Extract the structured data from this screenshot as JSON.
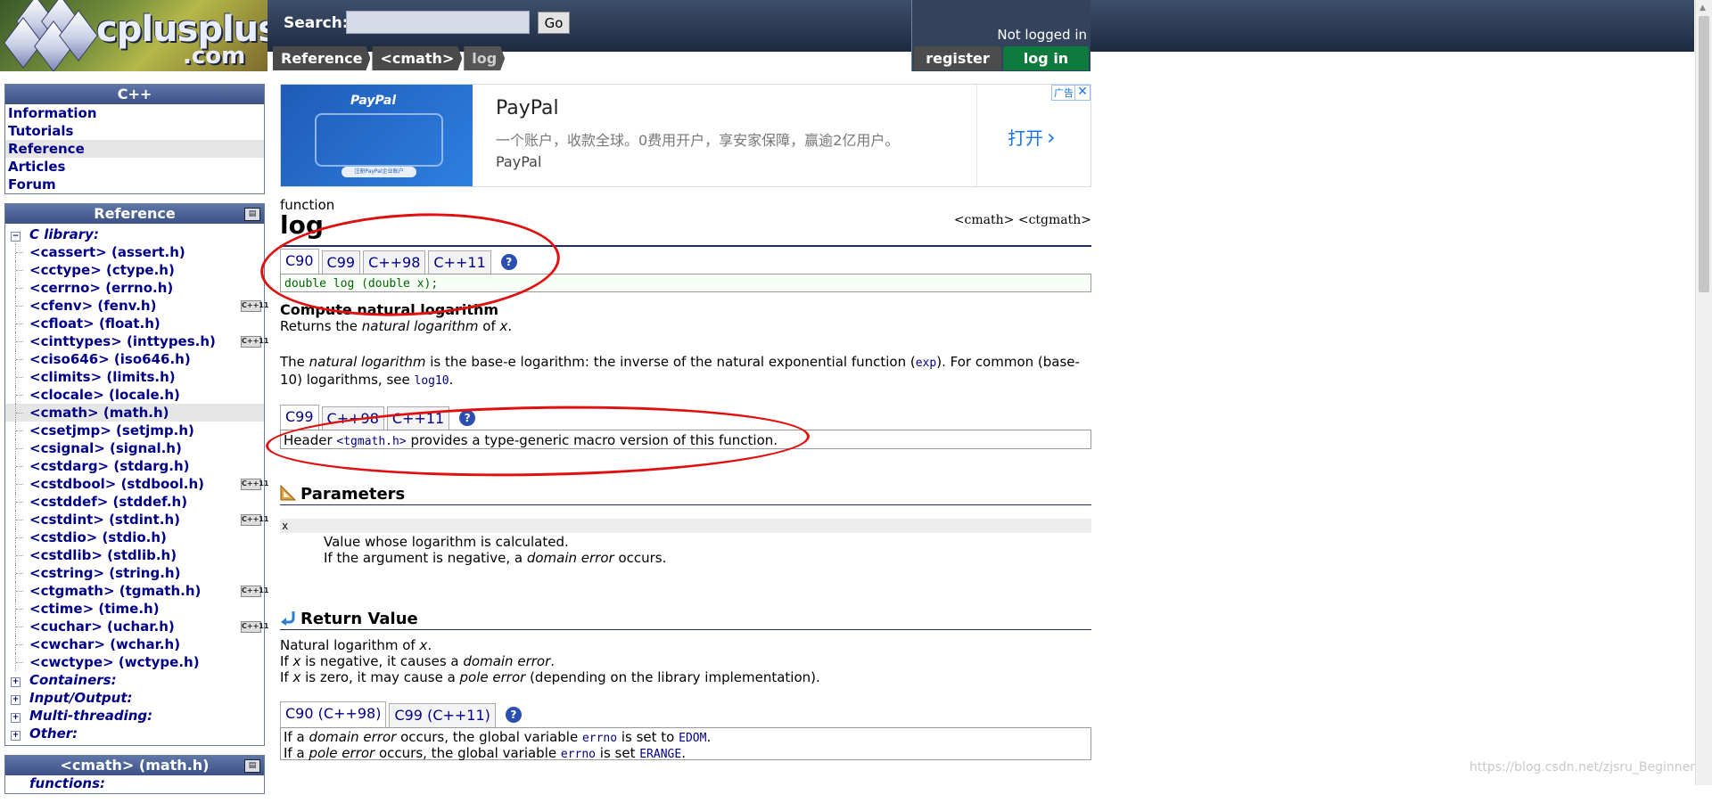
{
  "header": {
    "logo_text": "cplusplus",
    "logo_suffix": ".com",
    "search_label": "Search:",
    "search_value": "",
    "go_label": "Go",
    "login_status": "Not logged in",
    "register_label": "register",
    "login_label": "log in"
  },
  "breadcrumb": [
    "Reference",
    "<cmath>",
    "log"
  ],
  "sidebar": {
    "cpp_title": "C++",
    "cpp_items": [
      "Information",
      "Tutorials",
      "Reference",
      "Articles",
      "Forum"
    ],
    "reference_title": "Reference",
    "c_library_label": "C library:",
    "libraries": [
      {
        "label": "<cassert> (assert.h)",
        "badge": ""
      },
      {
        "label": "<cctype> (ctype.h)",
        "badge": ""
      },
      {
        "label": "<cerrno> (errno.h)",
        "badge": ""
      },
      {
        "label": "<cfenv> (fenv.h)",
        "badge": "C++11"
      },
      {
        "label": "<cfloat> (float.h)",
        "badge": ""
      },
      {
        "label": "<cinttypes> (inttypes.h)",
        "badge": "C++11"
      },
      {
        "label": "<ciso646> (iso646.h)",
        "badge": ""
      },
      {
        "label": "<climits> (limits.h)",
        "badge": ""
      },
      {
        "label": "<clocale> (locale.h)",
        "badge": ""
      },
      {
        "label": "<cmath> (math.h)",
        "badge": ""
      },
      {
        "label": "<csetjmp> (setjmp.h)",
        "badge": ""
      },
      {
        "label": "<csignal> (signal.h)",
        "badge": ""
      },
      {
        "label": "<cstdarg> (stdarg.h)",
        "badge": ""
      },
      {
        "label": "<cstdbool> (stdbool.h)",
        "badge": "C++11"
      },
      {
        "label": "<cstddef> (stddef.h)",
        "badge": ""
      },
      {
        "label": "<cstdint> (stdint.h)",
        "badge": "C++11"
      },
      {
        "label": "<cstdio> (stdio.h)",
        "badge": ""
      },
      {
        "label": "<cstdlib> (stdlib.h)",
        "badge": ""
      },
      {
        "label": "<cstring> (string.h)",
        "badge": ""
      },
      {
        "label": "<ctgmath> (tgmath.h)",
        "badge": "C++11"
      },
      {
        "label": "<ctime> (time.h)",
        "badge": ""
      },
      {
        "label": "<cuchar> (uchar.h)",
        "badge": "C++11"
      },
      {
        "label": "<cwchar> (wchar.h)",
        "badge": ""
      },
      {
        "label": "<cwctype> (wctype.h)",
        "badge": ""
      }
    ],
    "categories": [
      "Containers:",
      "Input/Output:",
      "Multi-threading:",
      "Other:"
    ],
    "cmath_title": "<cmath> (math.h)",
    "functions_label": "functions:"
  },
  "ad": {
    "image_brand": "PayPal",
    "image_caption": "注册PayPal企业账户",
    "title": "PayPal",
    "description": "一个账户，收款全球。0费用开户，享安家保障，赢逾2亿用户。",
    "brand": "PayPal",
    "open_label": "打开",
    "tag": "广告",
    "close": "✕"
  },
  "content": {
    "kind": "function",
    "name": "log",
    "headers": "<cmath> <ctgmath>",
    "proto_tabs": [
      "C90",
      "C99",
      "C++98",
      "C++11"
    ],
    "prototype": "double log (double x);",
    "section_head": "Compute natural logarithm",
    "summary_pre": "Returns the ",
    "summary_em": "natural logarithm",
    "summary_mid": " of ",
    "summary_x": "x",
    "summary_end": ".",
    "desc_pre": "The ",
    "desc_em": "natural logarithm",
    "desc_mid": " is the base-e logarithm: the inverse of the natural exponential function (",
    "desc_exp": "exp",
    "desc_mid2": "). For common (base-10) logarithms, see ",
    "desc_log10": "log10",
    "desc_end": ".",
    "tg_tabs": [
      "C99",
      "C++98",
      "C++11"
    ],
    "tg_pre": "Header ",
    "tg_header": "<tgmath.h>",
    "tg_post": " provides a type-generic macro version of this function.",
    "help": "?",
    "params_title": "Parameters",
    "param_name": "x",
    "param_desc1": "Value whose logarithm is calculated.",
    "param_desc2_pre": "If the argument is negative, a ",
    "param_desc2_em": "domain error",
    "param_desc2_post": " occurs.",
    "return_title": "Return Value",
    "ret1_pre": "Natural logarithm of ",
    "ret1_x": "x",
    "ret1_end": ".",
    "ret2_pre": "If ",
    "ret2_x": "x",
    "ret2_mid": " is negative, it causes a ",
    "ret2_em": "domain error",
    "ret2_end": ".",
    "ret3_pre": "If ",
    "ret3_x": "x",
    "ret3_mid": " is zero, it may cause a ",
    "ret3_em": "pole error",
    "ret3_end": " (depending on the library implementation).",
    "err_tabs": [
      "C90 (C++98)",
      "C99 (C++11)"
    ],
    "err1_pre": "If a ",
    "err1_em": "domain error",
    "err1_mid": " occurs, the global variable ",
    "err1_var": "errno",
    "err1_mid2": " is set to ",
    "err1_val": "EDOM",
    "err1_end": ".",
    "err2_pre": "If a ",
    "err2_em": "pole error",
    "err2_mid": " occurs, the global variable ",
    "err2_var": "errno",
    "err2_mid2": " is set ",
    "err2_val": "ERANGE",
    "err2_end": "."
  },
  "watermark": "https://blog.csdn.net/zjsru_Beginner",
  "colors": {
    "link": "#000087",
    "annotation": "#e01010",
    "title_rule": "#1c2b66",
    "login": "#0e7a3e"
  }
}
